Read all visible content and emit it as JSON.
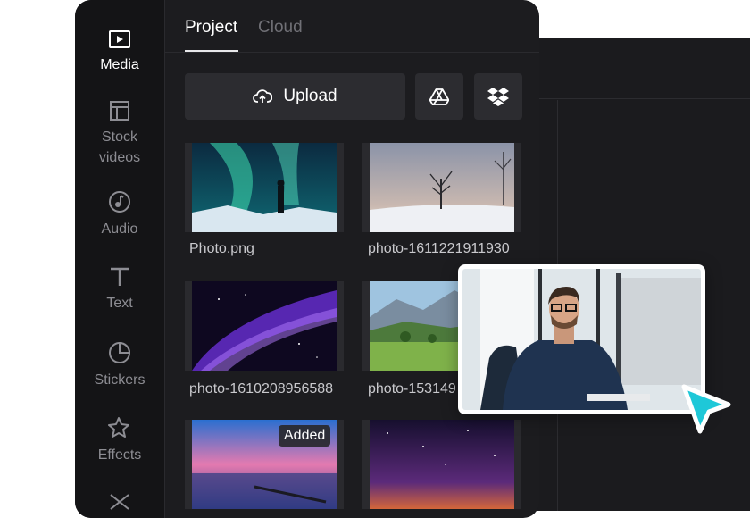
{
  "sidebar": {
    "items": [
      {
        "label": "Media",
        "icon": "play-square-icon",
        "active": true
      },
      {
        "label": "Stock videos",
        "icon": "layout-icon",
        "active": false
      },
      {
        "label": "Audio",
        "icon": "music-note-icon",
        "active": false
      },
      {
        "label": "Text",
        "icon": "text-t-icon",
        "active": false
      },
      {
        "label": "Stickers",
        "icon": "sticker-icon",
        "active": false
      },
      {
        "label": "Effects",
        "icon": "sparkle-icon",
        "active": false
      },
      {
        "label": "",
        "icon": "transition-icon",
        "active": false
      }
    ]
  },
  "tabs": [
    {
      "label": "Project",
      "active": true
    },
    {
      "label": "Cloud",
      "active": false
    }
  ],
  "toolbar": {
    "upload_label": "Upload",
    "upload_icon": "cloud-upload-icon",
    "drive_icon": "google-drive-icon",
    "dropbox_icon": "dropbox-icon"
  },
  "media": [
    {
      "label": "Photo.png",
      "image": "aurora-night-photo"
    },
    {
      "label": "photo-1611221911930",
      "image": "snowy-tree-photo"
    },
    {
      "label": "photo-1610208956588",
      "image": "purple-nebula-photo"
    },
    {
      "label": "photo-153149",
      "image": "mountain-meadow-photo"
    },
    {
      "label": "",
      "image": "lake-sunset-photo",
      "badge": "Added"
    },
    {
      "label": "",
      "image": "starry-sky-photo"
    }
  ],
  "overlay": {
    "image": "webcam-man-at-computer"
  },
  "colors": {
    "app_bg": "#1c1c1f",
    "sidebar_bg": "#141416",
    "button_bg": "#2c2c30",
    "active_text": "#ffffff",
    "inactive_text": "#8d8d93",
    "cursor": "#1ec8d8"
  }
}
